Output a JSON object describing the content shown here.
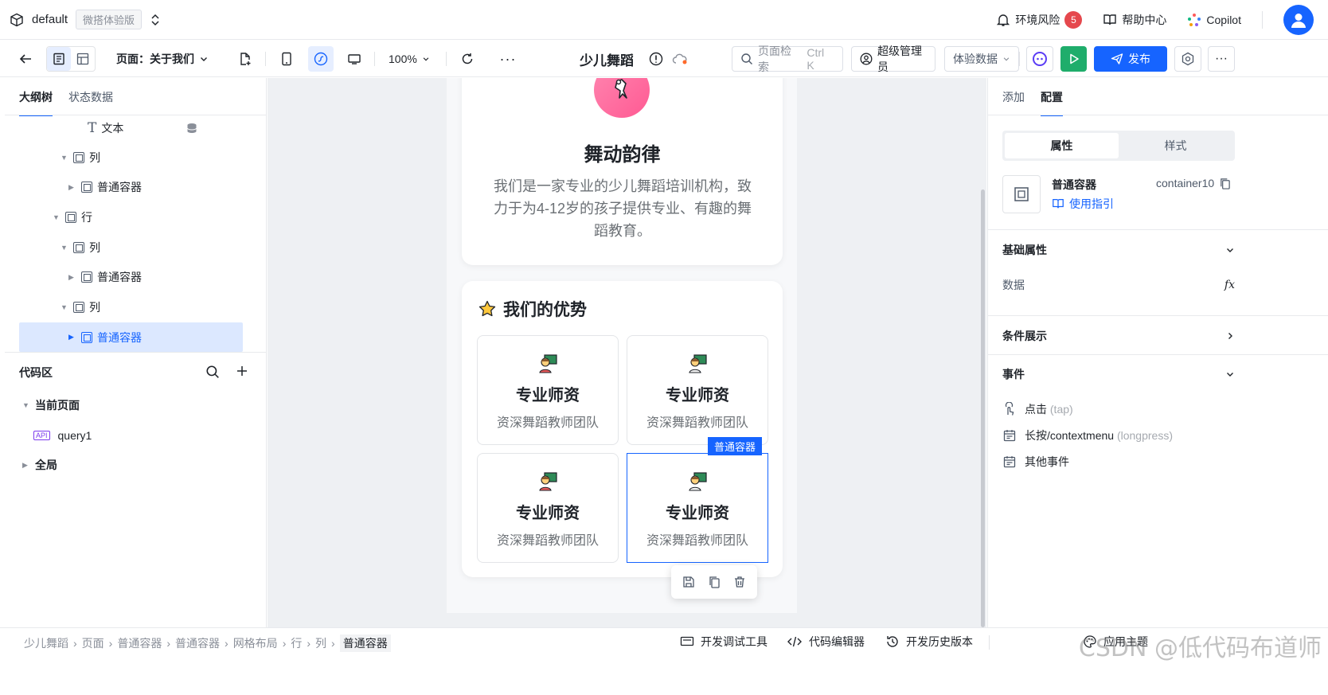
{
  "topbar": {
    "app_name": "default",
    "env_tag": "微搭体验版",
    "risk_label": "环境风险",
    "risk_count": "5",
    "help_label": "帮助中心",
    "copilot_label": "Copilot"
  },
  "toolbar": {
    "page_label": "页面：关于我们",
    "zoom": "100%",
    "app_title": "少儿舞蹈",
    "search_placeholder": "页面检索",
    "search_shortcut": "Ctrl K",
    "admin_label": "超级管理员",
    "data_select": "体验数据",
    "publish_label": "发布"
  },
  "left": {
    "tabs": [
      "大纲树",
      "状态数据"
    ],
    "tree": [
      {
        "label": "文本",
        "level": 3
      },
      {
        "label": "列",
        "level": 2
      },
      {
        "label": "普通容器",
        "level": 3
      },
      {
        "label": "行",
        "level": 1
      },
      {
        "label": "列",
        "level": 2
      },
      {
        "label": "普通容器",
        "level": 3
      },
      {
        "label": "列",
        "level": 2
      },
      {
        "label": "普通容器",
        "level": 3
      }
    ],
    "code_section": "代码区",
    "code_items": {
      "current_page": "当前页面",
      "query": "query1",
      "global": "全局",
      "api_tag": "API"
    }
  },
  "canvas": {
    "hero_title": "舞动韵律",
    "hero_desc_lines": [
      "我们是一家专业的少儿舞蹈培训机构，致",
      "力于为4-12岁的孩子提供专业、有趣的舞",
      "蹈教育。"
    ],
    "adv_title": "我们的优势",
    "features": [
      {
        "title": "专业师资",
        "desc": "资深舞蹈教师团队"
      },
      {
        "title": "专业师资",
        "desc": "资深舞蹈教师团队"
      },
      {
        "title": "专业师资",
        "desc": "资深舞蹈教师团队"
      },
      {
        "title": "专业师资",
        "desc": "资深舞蹈教师团队"
      }
    ],
    "selected_tag": "普通容器"
  },
  "right": {
    "tabs": [
      "添加",
      "配置"
    ],
    "seg": [
      "属性",
      "样式"
    ],
    "component_name": "普通容器",
    "component_id": "container10",
    "guide_label": "使用指引",
    "basic_props": "基础属性",
    "data_label": "数据",
    "condition": "条件展示",
    "events": "事件",
    "event_tap": "点击",
    "event_tap_sub": "(tap)",
    "event_long": "长按/contextmenu",
    "event_long_sub": "(longpress)",
    "event_other": "其他事件"
  },
  "bottom": {
    "crumbs": [
      "少儿舞蹈",
      "页面",
      "普通容器",
      "普通容器",
      "网格布局",
      "行",
      "列",
      "普通容器"
    ],
    "devtools": "开发调试工具",
    "code_editor": "代码编辑器",
    "history": "开发历史版本",
    "theme": "应用主题",
    "watermark": "CSDN @低代码布道师"
  },
  "colors": {
    "accent": "#1664ff",
    "run": "#1fad6b",
    "badge": "#e5484d"
  }
}
